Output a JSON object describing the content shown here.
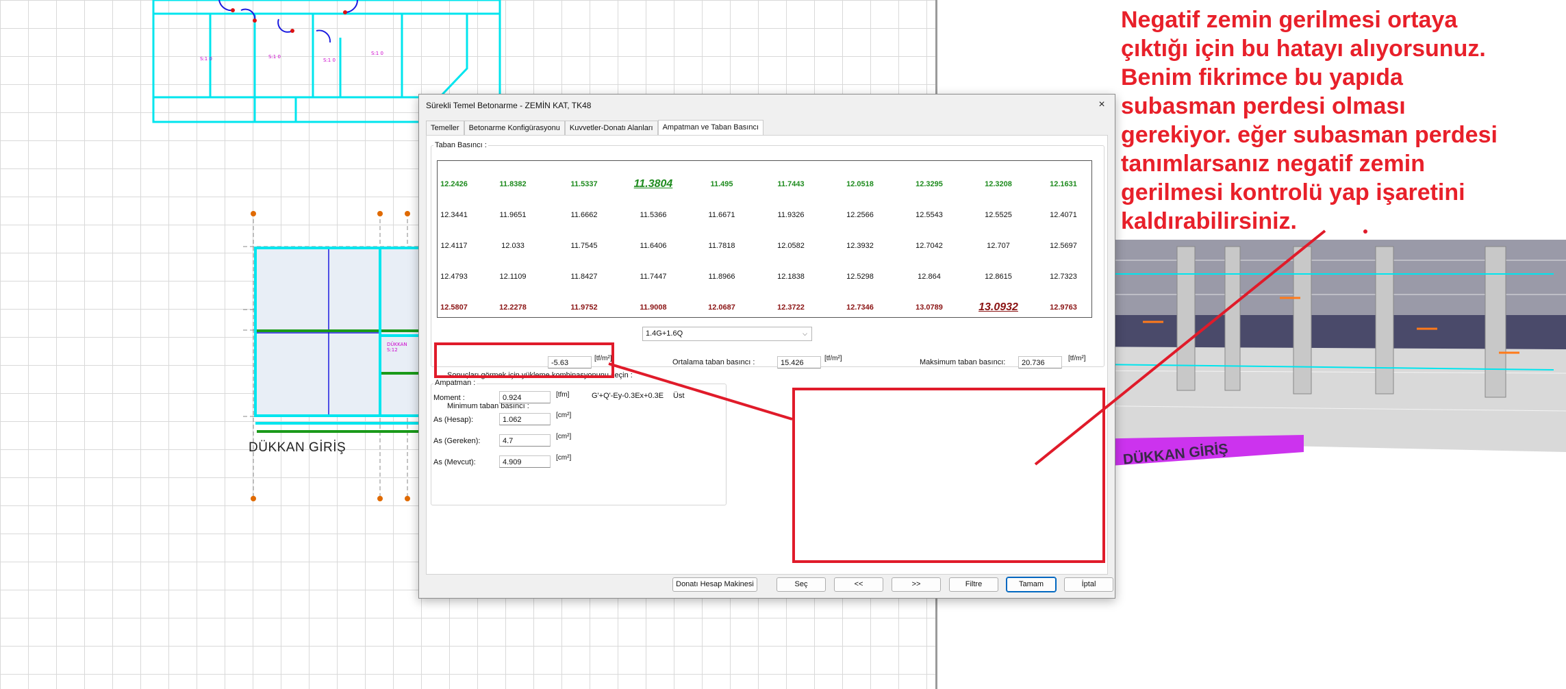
{
  "annotation": {
    "lines": [
      "Negatif zemin gerilmesi ortaya",
      "çıktığı için bu hatayı alıyorsunuz.",
      "Benim fikrimce bu yapıda",
      "subasman perdesi olması",
      "gerekiyor. eğer subasman perdesi",
      "tanımlarsanız negatif zemin",
      "gerilmesi kontrolü yap işaretini",
      "kaldırabilirsiniz."
    ],
    "color": "#e8202a"
  },
  "cad": {
    "plan_label": "DÜKKAN GİRİŞ",
    "model_label": "DÜKKAN GİRİŞ",
    "wall_color": "#00e5ee",
    "highlight_color": "#d400ff"
  },
  "dialog": {
    "title": "Sürekli Temel Betonarme - ZEMİN KAT, TK48",
    "close_icon": "×",
    "tabs": [
      "Temeller",
      "Betonarme Konfigürasyonu",
      "Kuvvetler-Donatı Alanları",
      "Ampatman ve Taban Basıncı"
    ],
    "active_tab": 3,
    "taban_title": "Taban Basıncı :",
    "pressure_grid": [
      [
        "12.2426",
        "11.8382",
        "11.5337",
        "11.3804",
        "11.495",
        "11.7443",
        "12.0518",
        "12.3295",
        "12.3208",
        "12.1631"
      ],
      [
        "12.3441",
        "11.9651",
        "11.6662",
        "11.5366",
        "11.6671",
        "11.9326",
        "12.2566",
        "12.5543",
        "12.5525",
        "12.4071"
      ],
      [
        "12.4117",
        "12.033",
        "11.7545",
        "11.6406",
        "11.7818",
        "12.0582",
        "12.3932",
        "12.7042",
        "12.707",
        "12.5697"
      ],
      [
        "12.4793",
        "12.1109",
        "11.8427",
        "11.7447",
        "11.8966",
        "12.1838",
        "12.5298",
        "12.864",
        "12.8615",
        "12.7323"
      ],
      [
        "12.5807",
        "12.2278",
        "11.9752",
        "11.9008",
        "12.0687",
        "12.3722",
        "12.7346",
        "13.0789",
        "13.0932",
        "12.9763"
      ]
    ],
    "min_highlight": {
      "row": 0,
      "col": 3
    },
    "max_highlight": {
      "row": 4,
      "col": 8
    },
    "combo_label": "Sonuçları görmek için yükleme kombinasyonunu seçin :",
    "combo_value": "1.4G+1.6Q",
    "min_label": "Minimum taban basıncı :",
    "min_value": "-5.63",
    "avg_label": "Ortalama taban basıncı :",
    "avg_value": "15.426",
    "max_label": "Maksimum taban basıncı:",
    "max_value": "20.736",
    "pressure_unit": "[tf/m²]",
    "ampatman_title": "Ampatman :",
    "moment_label": "Moment :",
    "moment_value": "0.924",
    "moment_unit": "[tfm]",
    "moment_combo": "G'+Q'-Ey-0.3Ex+0.3E",
    "moment_side": "Üst",
    "as_hesap_label": "As (Hesap):",
    "as_hesap_value": "1.062",
    "as_gereken_label": "As (Gereken):",
    "as_gereken_value": "4.7",
    "as_mevcut_label": "As (Mevcut):",
    "as_mevcut_value": "4.909",
    "area_unit": "[cm²]",
    "buttons": {
      "calculator": "Donatı Hesap Makinesi",
      "select": "Seç",
      "prev": "<<",
      "next": ">>",
      "filter": "Filtre",
      "ok": "Tamam",
      "cancel": "İptal"
    }
  }
}
